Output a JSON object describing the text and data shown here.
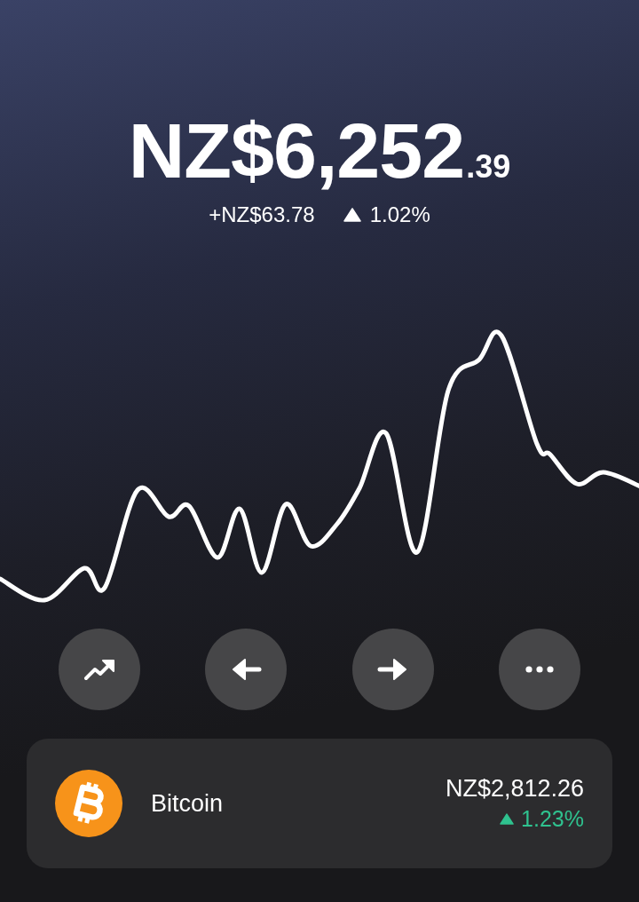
{
  "balance": {
    "whole": "NZ$6,252",
    "cents": ".39",
    "change": "+NZ$63.78",
    "rising": true,
    "percent": "1.02%"
  },
  "actions": [
    {
      "kind": "trend"
    },
    {
      "kind": "left"
    },
    {
      "kind": "right"
    },
    {
      "kind": "more"
    }
  ],
  "asset": {
    "name": "Bitcoin",
    "price": "NZ$2,812.26",
    "rising": true,
    "percent": "1.23%"
  }
}
